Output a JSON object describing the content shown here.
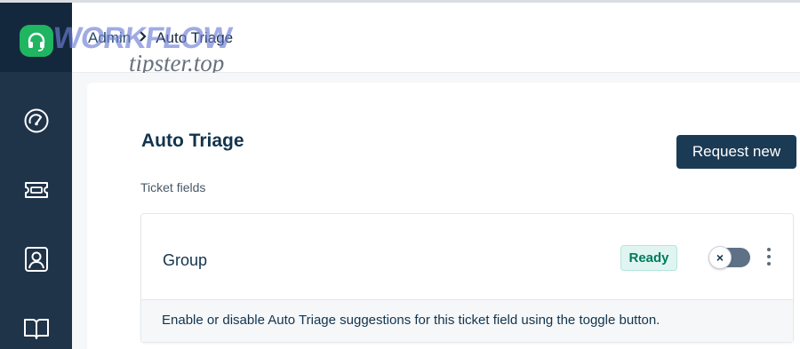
{
  "watermark": {
    "brand": "WORKFLOW",
    "site": "tipster.top"
  },
  "header": {
    "breadcrumb_root": "Admin",
    "breadcrumb_separator": ">",
    "breadcrumb_current": "Auto Triage"
  },
  "sidebar": {
    "items": [
      {
        "icon": "dashboard-icon"
      },
      {
        "icon": "tickets-icon"
      },
      {
        "icon": "contacts-icon"
      },
      {
        "icon": "knowledge-base-icon"
      }
    ]
  },
  "page": {
    "title": "Auto Triage",
    "request_button": "Request new",
    "section_label": "Ticket fields"
  },
  "field": {
    "name": "Group",
    "status": "Ready",
    "toggle_symbol": "×",
    "toggle_on": false,
    "description": "Enable or disable Auto Triage suggestions for this ticket field using the toggle button."
  },
  "colors": {
    "sidebar": "#1f3349",
    "brand_green": "#1fb561",
    "primary_button": "#1b3a54",
    "ready_text": "#00795b",
    "ready_bg": "#e0f5f1"
  }
}
